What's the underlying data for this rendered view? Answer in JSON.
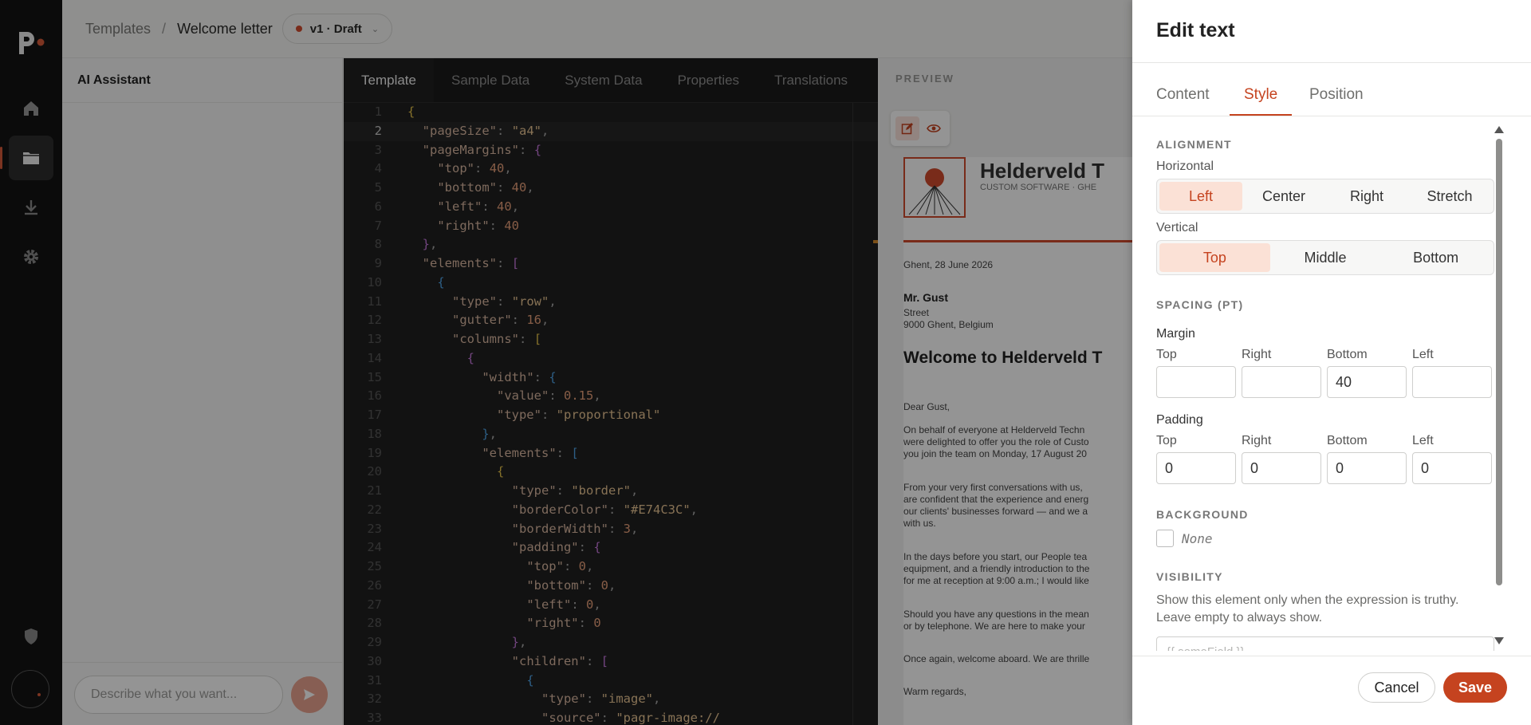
{
  "breadcrumb": {
    "parent": "Templates",
    "separator": "/",
    "current": "Welcome letter"
  },
  "version_badge": {
    "label": "v1 · Draft",
    "status_color": "#d14b2d"
  },
  "assistant": {
    "title": "AI Assistant",
    "placeholder": "Describe what you want..."
  },
  "editor": {
    "tabs": [
      {
        "label": "Template",
        "active": true
      },
      {
        "label": "Sample Data"
      },
      {
        "label": "System Data"
      },
      {
        "label": "Properties"
      },
      {
        "label": "Translations"
      }
    ],
    "lines": [
      "{",
      "  \"pageSize\": \"a4\",",
      "  \"pageMargins\": {",
      "    \"top\": 40,",
      "    \"bottom\": 40,",
      "    \"left\": 40,",
      "    \"right\": 40",
      "  },",
      "  \"elements\": [",
      "    {",
      "      \"type\": \"row\",",
      "      \"gutter\": 16,",
      "      \"columns\": [",
      "        {",
      "          \"width\": {",
      "            \"value\": 0.15,",
      "            \"type\": \"proportional\"",
      "          },",
      "          \"elements\": [",
      "            {",
      "              \"type\": \"border\",",
      "              \"borderColor\": \"#E74C3C\",",
      "              \"borderWidth\": 3,",
      "              \"padding\": {",
      "                \"top\": 0,",
      "                \"bottom\": 0,",
      "                \"left\": 0,",
      "                \"right\": 0",
      "              },",
      "              \"children\": [",
      "                {",
      "                  \"type\": \"image\",",
      "                  \"source\": \"pagr-image://"
    ]
  },
  "preview": {
    "label": "PREVIEW",
    "company": "Helderveld T",
    "tagline": "CUSTOM SOFTWARE · GHE",
    "date": "Ghent, 28 June 2026",
    "recipient_name": "Mr. Gust",
    "recipient_street": "Street",
    "recipient_city": "9000 Ghent, Belgium",
    "heading": "Welcome to Helderveld T",
    "salutation": "Dear Gust,",
    "para1": [
      "On behalf of everyone at Helderveld Techn",
      "were delighted to offer you the role of Custo",
      "you join the team on Monday, 17 August 20"
    ],
    "para2": [
      "From your very first conversations with us, ",
      "are confident that the experience and energ",
      "our clients' businesses forward — and we a",
      "with us."
    ],
    "para3": [
      "In the days before you start, our People tea",
      "equipment, and a friendly introduction to the",
      "for me at reception at 9:00 a.m.; I would like"
    ],
    "para4": [
      "Should you have any questions in the mean",
      "or by telephone. We are here to make your"
    ],
    "para5": "Once again, welcome aboard. We are thrille",
    "closing": "Warm regards,",
    "accent_color": "#d14b2d"
  },
  "drawer": {
    "title": "Edit text",
    "tabs": [
      {
        "label": "Content"
      },
      {
        "label": "Style",
        "active": true
      },
      {
        "label": "Position"
      }
    ],
    "alignment": {
      "section": "ALIGNMENT",
      "horizontal_label": "Horizontal",
      "horizontal_options": [
        "Left",
        "Center",
        "Right",
        "Stretch"
      ],
      "horizontal_selected": "Left",
      "vertical_label": "Vertical",
      "vertical_options": [
        "Top",
        "Middle",
        "Bottom"
      ],
      "vertical_selected": "Top"
    },
    "spacing": {
      "section": "SPACING (PT)",
      "margin_label": "Margin",
      "padding_label": "Padding",
      "side_labels": [
        "Top",
        "Right",
        "Bottom",
        "Left"
      ],
      "margin_values": [
        "",
        "",
        "40",
        ""
      ],
      "padding_values": [
        "0",
        "0",
        "0",
        "0"
      ]
    },
    "background": {
      "section": "BACKGROUND",
      "value": "None"
    },
    "visibility": {
      "section": "VISIBILITY",
      "help": "Show this element only when the expression is truthy. Leave empty to always show.",
      "placeholder": "{{ someField }}"
    },
    "cancel_label": "Cancel",
    "save_label": "Save",
    "accent_color": "#c5431f"
  }
}
